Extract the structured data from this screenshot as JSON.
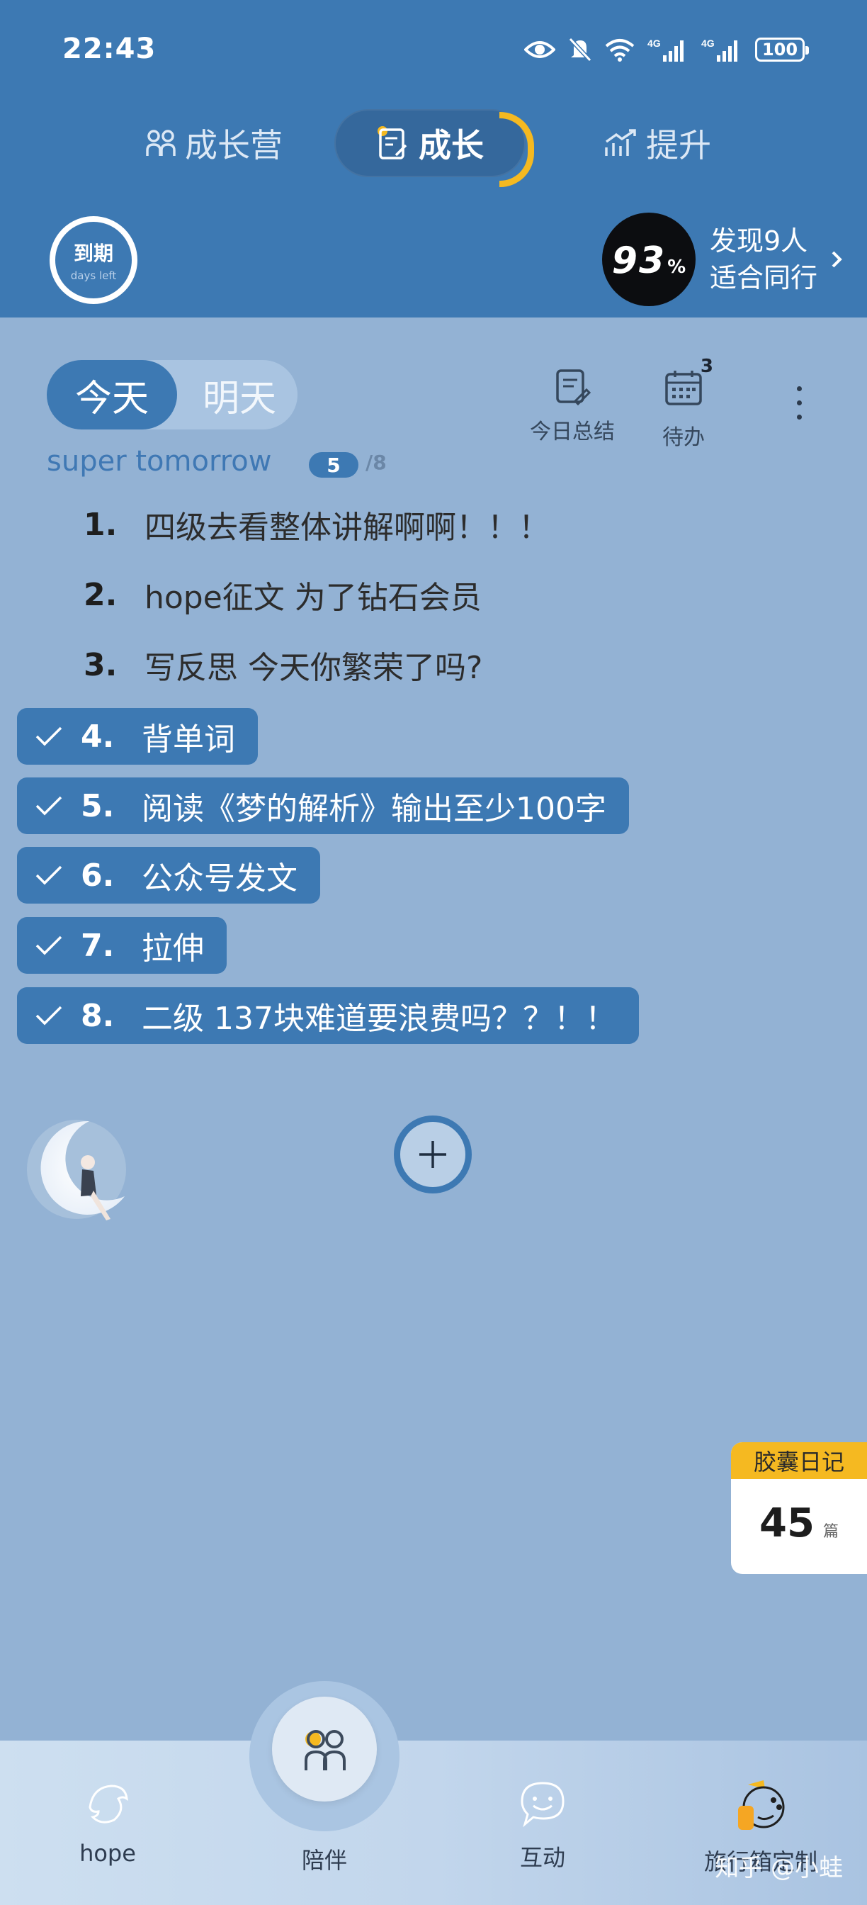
{
  "status_bar": {
    "time": "22:43",
    "icons": [
      "eye-icon",
      "bell-off-icon",
      "wifi-icon",
      "signal-4g-icon",
      "signal-4g-icon"
    ],
    "signal_label": "4G",
    "battery": "100"
  },
  "top_tabs": {
    "camp": "成长营",
    "grow": "成长",
    "lift": "提升"
  },
  "expiry": {
    "label": "到期",
    "sub": "days left"
  },
  "match": {
    "percent": "93",
    "percent_sign": "%",
    "line1": "发现9人",
    "line2": "适合同行"
  },
  "day_switch": {
    "today": "今天",
    "tomorrow": "明天"
  },
  "tools": {
    "summary": "今日总结",
    "todo": "待办",
    "todo_badge": "3"
  },
  "list": {
    "name": "super tomorrow",
    "done_count": "5",
    "total": "/8"
  },
  "tasks": [
    {
      "num": "1.",
      "text": "四级去看整体讲解啊啊！！！",
      "done": false
    },
    {
      "num": "2.",
      "text": "hope征文 为了钻石会员",
      "done": false
    },
    {
      "num": "3.",
      "text": "写反思 今天你繁荣了吗?",
      "done": false
    },
    {
      "num": "4.",
      "text": "背单词",
      "done": true
    },
    {
      "num": "5.",
      "text": "阅读《梦的解析》输出至少100字",
      "done": true
    },
    {
      "num": "6.",
      "text": "公众号发文",
      "done": true
    },
    {
      "num": "7.",
      "text": "拉伸",
      "done": true
    },
    {
      "num": "8.",
      "text": "二级 137块难道要浪费吗？？！！",
      "done": true
    }
  ],
  "capsule": {
    "title": "胶囊日记",
    "count": "45",
    "unit": "篇"
  },
  "bottom_nav": {
    "hope": "hope",
    "companion": "陪伴",
    "interact": "互动",
    "suitcase": "旅行箱定制"
  },
  "watermark": "知乎 @小蛙",
  "colors": {
    "primary": "#3d79b3",
    "background": "#93b2d4",
    "accent": "#f5b921"
  }
}
